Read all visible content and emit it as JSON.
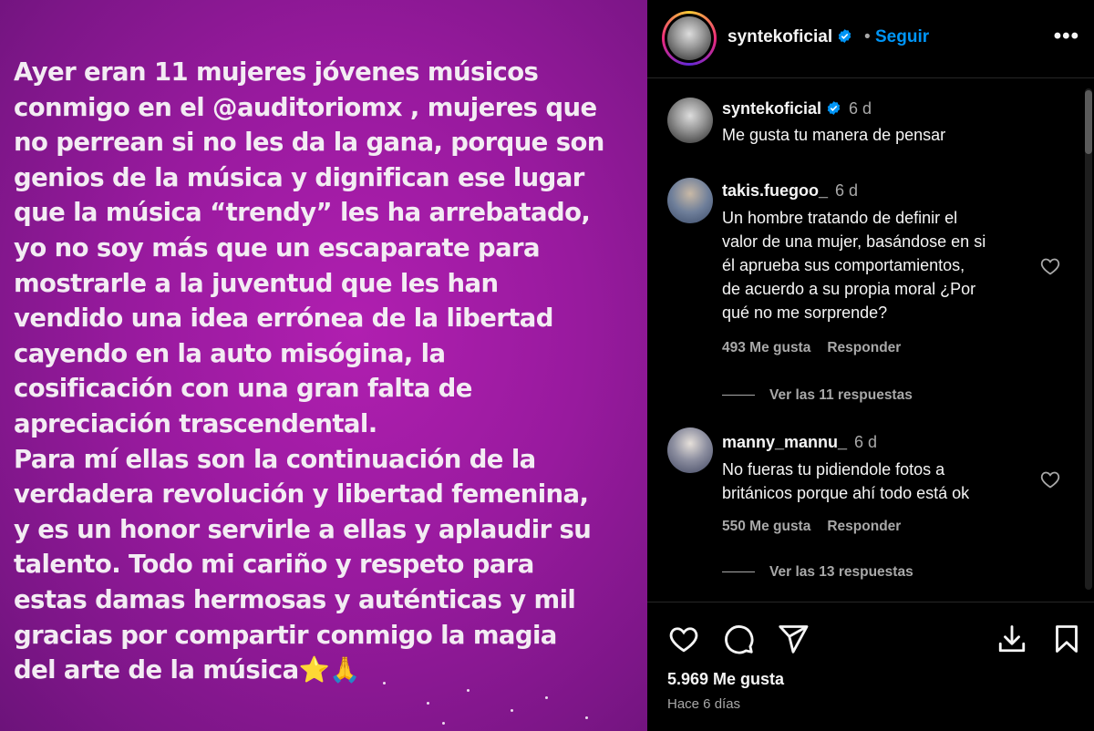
{
  "story": {
    "text": "Ayer eran 11 mujeres jóvenes músicos\nconmigo en el @auditoriomx , mujeres que\nno perrean si no les da la gana, porque son\ngenios de la música y dignifican ese lugar\nque la música “trendy” les ha arrebatado,\nyo no soy más que un escaparate para\nmostrarle a la juventud  que les han\nvendido una idea errónea de la libertad\ncayendo en la auto misógina, la\ncosificación con una gran falta de\napreciación trascendental.\nPara mí ellas son la continuación de la\nverdadera revolución y libertad femenina,\ny es un honor servirle a ellas y aplaudir su\ntalento. Todo mi cariño  y respeto para\nestas damas hermosas y auténticas y mil\ngracias por compartir conmigo la magia\ndel arte de la música⭐🙏",
    "background_colors": [
      "#b01fb0",
      "#981a9e",
      "#6c137a"
    ]
  },
  "header": {
    "username": "syntekoficial",
    "separator": "•",
    "follow_label": "Seguir",
    "more_icon": "more-horizontal-icon",
    "more_label": "•••"
  },
  "comments": [
    {
      "username": "syntekoficial",
      "verified": true,
      "time": "6 d",
      "text": "Me gusta tu manera de pensar"
    },
    {
      "username": "takis.fuegoo_",
      "time": "6 d",
      "text": "Un hombre tratando de definir el\nvalor de una mujer, basándose en si\nél aprueba sus comportamientos,\nde acuerdo a su propia moral ¿Por\nqué no me sorprende?",
      "likes": "493 Me gusta",
      "reply_label": "Responder",
      "view_replies": "Ver las 11 respuestas"
    },
    {
      "username": "manny_mannu_",
      "time": "6 d",
      "text": "No fueras tu pidiendole fotos a\nbritánicos porque ahí todo está ok",
      "likes": "550 Me gusta",
      "reply_label": "Responder",
      "view_replies": "Ver las 13 respuestas"
    }
  ],
  "post": {
    "likes": "5.969 Me gusta",
    "time_ago": "Hace 6 días"
  },
  "colors": {
    "accent": "#0095f6",
    "verified": "#0095f6",
    "text_primary": "#f5f5f5",
    "text_secondary": "#a8a8a8",
    "background": "#000000"
  }
}
